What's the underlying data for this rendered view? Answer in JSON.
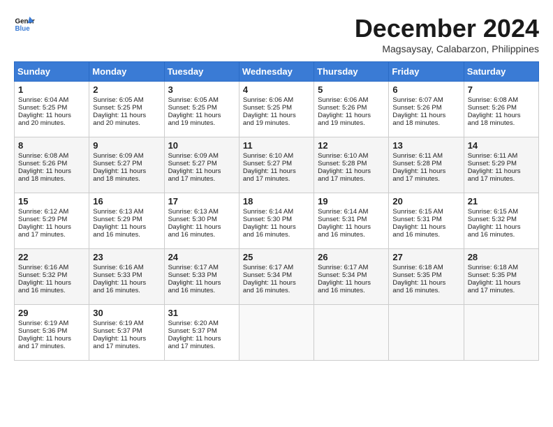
{
  "header": {
    "logo_line1": "General",
    "logo_line2": "Blue",
    "month_title": "December 2024",
    "subtitle": "Magsaysay, Calabarzon, Philippines"
  },
  "days_of_week": [
    "Sunday",
    "Monday",
    "Tuesday",
    "Wednesday",
    "Thursday",
    "Friday",
    "Saturday"
  ],
  "weeks": [
    [
      {
        "day": "1",
        "lines": [
          "Sunrise: 6:04 AM",
          "Sunset: 5:25 PM",
          "Daylight: 11 hours",
          "and 20 minutes."
        ]
      },
      {
        "day": "2",
        "lines": [
          "Sunrise: 6:05 AM",
          "Sunset: 5:25 PM",
          "Daylight: 11 hours",
          "and 20 minutes."
        ]
      },
      {
        "day": "3",
        "lines": [
          "Sunrise: 6:05 AM",
          "Sunset: 5:25 PM",
          "Daylight: 11 hours",
          "and 19 minutes."
        ]
      },
      {
        "day": "4",
        "lines": [
          "Sunrise: 6:06 AM",
          "Sunset: 5:25 PM",
          "Daylight: 11 hours",
          "and 19 minutes."
        ]
      },
      {
        "day": "5",
        "lines": [
          "Sunrise: 6:06 AM",
          "Sunset: 5:26 PM",
          "Daylight: 11 hours",
          "and 19 minutes."
        ]
      },
      {
        "day": "6",
        "lines": [
          "Sunrise: 6:07 AM",
          "Sunset: 5:26 PM",
          "Daylight: 11 hours",
          "and 18 minutes."
        ]
      },
      {
        "day": "7",
        "lines": [
          "Sunrise: 6:08 AM",
          "Sunset: 5:26 PM",
          "Daylight: 11 hours",
          "and 18 minutes."
        ]
      }
    ],
    [
      {
        "day": "8",
        "lines": [
          "Sunrise: 6:08 AM",
          "Sunset: 5:26 PM",
          "Daylight: 11 hours",
          "and 18 minutes."
        ]
      },
      {
        "day": "9",
        "lines": [
          "Sunrise: 6:09 AM",
          "Sunset: 5:27 PM",
          "Daylight: 11 hours",
          "and 18 minutes."
        ]
      },
      {
        "day": "10",
        "lines": [
          "Sunrise: 6:09 AM",
          "Sunset: 5:27 PM",
          "Daylight: 11 hours",
          "and 17 minutes."
        ]
      },
      {
        "day": "11",
        "lines": [
          "Sunrise: 6:10 AM",
          "Sunset: 5:27 PM",
          "Daylight: 11 hours",
          "and 17 minutes."
        ]
      },
      {
        "day": "12",
        "lines": [
          "Sunrise: 6:10 AM",
          "Sunset: 5:28 PM",
          "Daylight: 11 hours",
          "and 17 minutes."
        ]
      },
      {
        "day": "13",
        "lines": [
          "Sunrise: 6:11 AM",
          "Sunset: 5:28 PM",
          "Daylight: 11 hours",
          "and 17 minutes."
        ]
      },
      {
        "day": "14",
        "lines": [
          "Sunrise: 6:11 AM",
          "Sunset: 5:29 PM",
          "Daylight: 11 hours",
          "and 17 minutes."
        ]
      }
    ],
    [
      {
        "day": "15",
        "lines": [
          "Sunrise: 6:12 AM",
          "Sunset: 5:29 PM",
          "Daylight: 11 hours",
          "and 17 minutes."
        ]
      },
      {
        "day": "16",
        "lines": [
          "Sunrise: 6:13 AM",
          "Sunset: 5:29 PM",
          "Daylight: 11 hours",
          "and 16 minutes."
        ]
      },
      {
        "day": "17",
        "lines": [
          "Sunrise: 6:13 AM",
          "Sunset: 5:30 PM",
          "Daylight: 11 hours",
          "and 16 minutes."
        ]
      },
      {
        "day": "18",
        "lines": [
          "Sunrise: 6:14 AM",
          "Sunset: 5:30 PM",
          "Daylight: 11 hours",
          "and 16 minutes."
        ]
      },
      {
        "day": "19",
        "lines": [
          "Sunrise: 6:14 AM",
          "Sunset: 5:31 PM",
          "Daylight: 11 hours",
          "and 16 minutes."
        ]
      },
      {
        "day": "20",
        "lines": [
          "Sunrise: 6:15 AM",
          "Sunset: 5:31 PM",
          "Daylight: 11 hours",
          "and 16 minutes."
        ]
      },
      {
        "day": "21",
        "lines": [
          "Sunrise: 6:15 AM",
          "Sunset: 5:32 PM",
          "Daylight: 11 hours",
          "and 16 minutes."
        ]
      }
    ],
    [
      {
        "day": "22",
        "lines": [
          "Sunrise: 6:16 AM",
          "Sunset: 5:32 PM",
          "Daylight: 11 hours",
          "and 16 minutes."
        ]
      },
      {
        "day": "23",
        "lines": [
          "Sunrise: 6:16 AM",
          "Sunset: 5:33 PM",
          "Daylight: 11 hours",
          "and 16 minutes."
        ]
      },
      {
        "day": "24",
        "lines": [
          "Sunrise: 6:17 AM",
          "Sunset: 5:33 PM",
          "Daylight: 11 hours",
          "and 16 minutes."
        ]
      },
      {
        "day": "25",
        "lines": [
          "Sunrise: 6:17 AM",
          "Sunset: 5:34 PM",
          "Daylight: 11 hours",
          "and 16 minutes."
        ]
      },
      {
        "day": "26",
        "lines": [
          "Sunrise: 6:17 AM",
          "Sunset: 5:34 PM",
          "Daylight: 11 hours",
          "and 16 minutes."
        ]
      },
      {
        "day": "27",
        "lines": [
          "Sunrise: 6:18 AM",
          "Sunset: 5:35 PM",
          "Daylight: 11 hours",
          "and 16 minutes."
        ]
      },
      {
        "day": "28",
        "lines": [
          "Sunrise: 6:18 AM",
          "Sunset: 5:35 PM",
          "Daylight: 11 hours",
          "and 17 minutes."
        ]
      }
    ],
    [
      {
        "day": "29",
        "lines": [
          "Sunrise: 6:19 AM",
          "Sunset: 5:36 PM",
          "Daylight: 11 hours",
          "and 17 minutes."
        ]
      },
      {
        "day": "30",
        "lines": [
          "Sunrise: 6:19 AM",
          "Sunset: 5:37 PM",
          "Daylight: 11 hours",
          "and 17 minutes."
        ]
      },
      {
        "day": "31",
        "lines": [
          "Sunrise: 6:20 AM",
          "Sunset: 5:37 PM",
          "Daylight: 11 hours",
          "and 17 minutes."
        ]
      },
      {
        "day": "",
        "lines": []
      },
      {
        "day": "",
        "lines": []
      },
      {
        "day": "",
        "lines": []
      },
      {
        "day": "",
        "lines": []
      }
    ]
  ]
}
